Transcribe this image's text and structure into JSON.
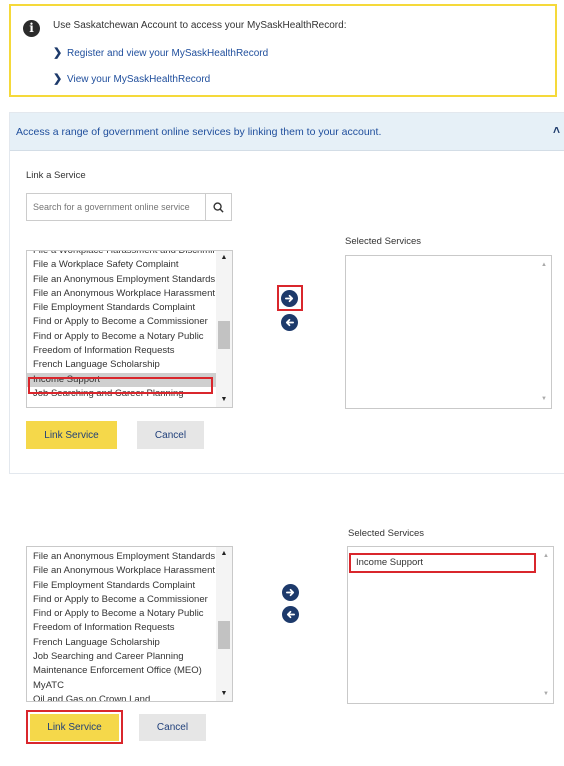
{
  "notice": {
    "intro": "Use Saskatchewan Account to access your MySaskHealthRecord:",
    "links": [
      "Register and view your MySaskHealthRecord",
      "View your MySaskHealthRecord"
    ]
  },
  "panel": {
    "title": "Access a range of government online services by linking them to your account.",
    "link_label": "Link a Service",
    "search_placeholder": "Search for a government online service",
    "selected_label": "Selected Services",
    "list_top": [
      "File a Workplace Harassment and Discrimination",
      "File a Workplace Safety Complaint",
      "File an Anonymous Employment Standards",
      "File an Anonymous Workplace Harassment",
      "File Employment Standards Complaint",
      "Find or Apply to Become a Commissioner",
      "Find or Apply to Become a Notary Public",
      "Freedom of Information Requests",
      "French Language Scholarship",
      "Income Support",
      "Job Searching and Career Planning"
    ],
    "link_button": "Link Service",
    "cancel_button": "Cancel"
  },
  "step2": {
    "selected_label": "Selected Services",
    "list_items": [
      "File an Anonymous Employment Standards",
      "File an Anonymous Workplace Harassment",
      "File Employment Standards Complaint",
      "Find or Apply to Become a Commissioner",
      "Find or Apply to Become a Notary Public",
      "Freedom of Information Requests",
      "French Language Scholarship",
      "Job Searching and Career Planning",
      "Maintenance Enforcement Office (MEO)",
      "MyATC",
      "Oil and Gas on Crown Land"
    ],
    "selected_items": [
      "Income Support"
    ],
    "link_button": "Link Service",
    "cancel_button": "Cancel"
  },
  "colors": {
    "accent_yellow": "#f5d84a",
    "brand_blue": "#1d3a6b",
    "link_blue": "#1f4e9c",
    "highlight_red": "#d9262c"
  }
}
